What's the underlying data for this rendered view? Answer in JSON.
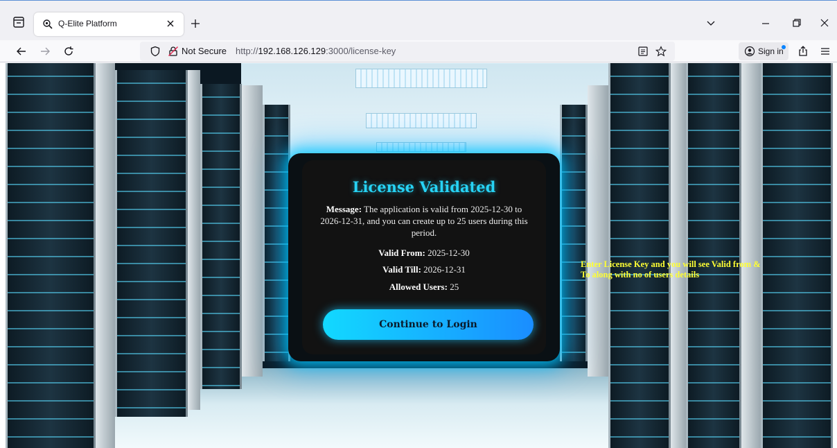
{
  "browser": {
    "tab_title": "Q-Elite Platform",
    "url_prefix": "http://",
    "url_host": "192.168.126.129",
    "url_rest": ":3000/license-key",
    "security_label": "Not Secure",
    "sign_in_label": "Sign in",
    "accent_color": "#0a84ff"
  },
  "license": {
    "title": "License Validated",
    "message_label": "Message:",
    "message_text": "The application is valid from 2025-12-30 to 2026-12-31, and you can create up to 25 users during this period.",
    "valid_from_label": "Valid From:",
    "valid_from": "2025-12-30",
    "valid_till_label": "Valid Till:",
    "valid_till": "2026-12-31",
    "allowed_users_label": "Allowed Users:",
    "allowed_users": "25",
    "continue_label": "Continue to Login",
    "title_color": "#27d3f5",
    "button_gradient": [
      "#12d9ff",
      "#1a8dff"
    ]
  },
  "annotation": {
    "text": "Enter License Key and you will see Valid from & To along with no of users details",
    "color": "#ffff33"
  }
}
